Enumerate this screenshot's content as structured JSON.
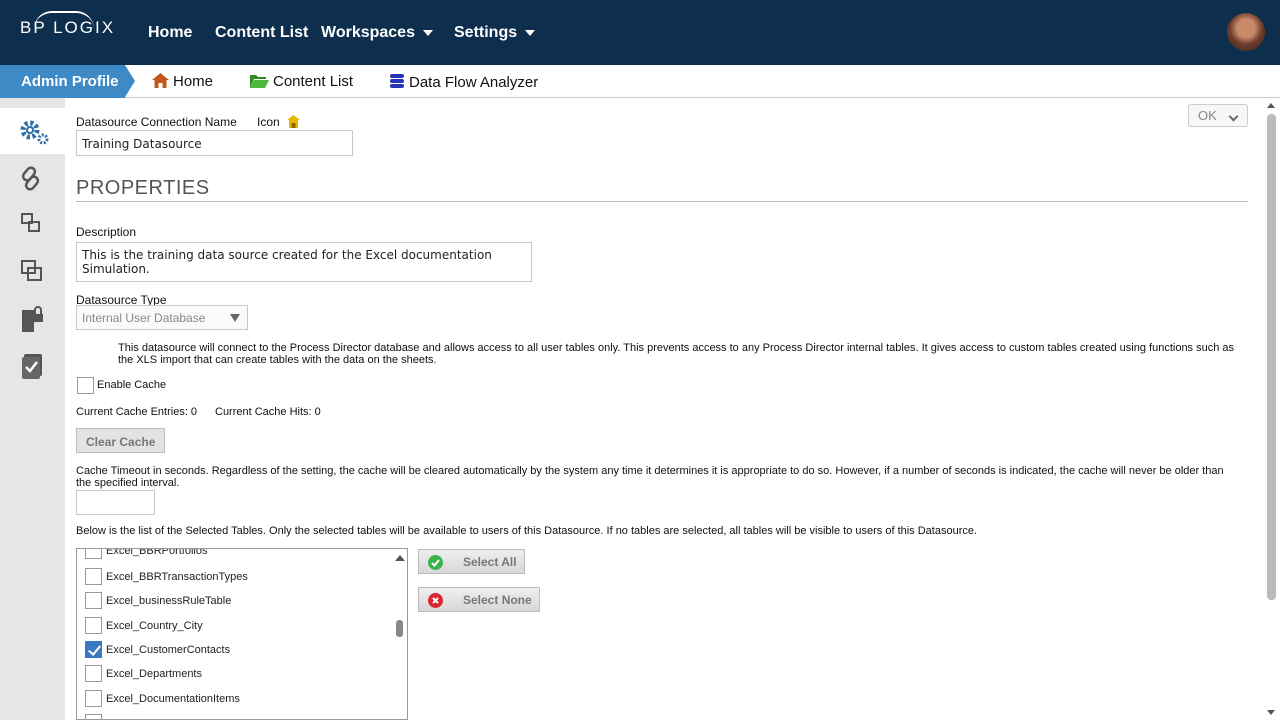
{
  "topnav": {
    "logo": "BP LOGIX",
    "items": [
      {
        "label": "Home"
      },
      {
        "label": "Content List"
      },
      {
        "label": "Workspaces"
      },
      {
        "label": "Settings"
      }
    ],
    "bg_color": "#0d2e4d"
  },
  "breadcrumb": {
    "active": "Admin Profile",
    "items": [
      {
        "label": "Home",
        "icon": "house-icon"
      },
      {
        "label": "Content List",
        "icon": "folder-open-icon"
      },
      {
        "label": "Data Flow Analyzer",
        "icon": "database-icon"
      }
    ],
    "accent_color": "#3e8ac7"
  },
  "sidebar": {
    "icons": [
      "gears-icon",
      "link-icon",
      "relations-icon",
      "copy-icon",
      "lock-document-icon",
      "checklist-icon"
    ]
  },
  "form": {
    "ok_label": "OK",
    "conn_name_label": "Datasource Connection Name",
    "icon_label": "Icon",
    "conn_name_value": "Training Datasource",
    "section_title": "PROPERTIES",
    "description_label": "Description",
    "description_value": "This is the training data source created for the Excel documentation Simulation.",
    "type_label": "Datasource Type",
    "type_value": "Internal User Database",
    "type_help": "This datasource will connect to the Process Director database and allows access to all user tables only. This prevents access to any Process Director internal tables. It gives access to custom tables created using functions such as the XLS import that can create tables with the data on the sheets.",
    "enable_cache_label": "Enable Cache",
    "cache_entries_label": "Current Cache Entries: 0",
    "cache_hits_label": "Current Cache Hits: 0",
    "clear_cache_label": "Clear Cache",
    "timeout_help": "Cache Timeout in seconds. Regardless of the setting, the cache will be cleared automatically by the system any time it determines it is appropriate to do so. However, if a number of seconds is indicated, the cache will never be older than the specified interval.",
    "timeout_value": "",
    "tables_help": "Below is the list of the Selected Tables. Only the selected tables will be available to users of this Datasource. If no tables are selected, all tables will be visible to users of this Datasource.",
    "select_all_label": "Select All",
    "select_none_label": "Select None"
  },
  "tables": [
    {
      "name": "Excel_BBRPortfolios",
      "checked": false
    },
    {
      "name": "Excel_BBRTransactionTypes",
      "checked": false
    },
    {
      "name": "Excel_businessRuleTable",
      "checked": false
    },
    {
      "name": "Excel_Country_City",
      "checked": false
    },
    {
      "name": "Excel_CustomerContacts",
      "checked": true
    },
    {
      "name": "Excel_Departments",
      "checked": false
    },
    {
      "name": "Excel_DocumentationItems",
      "checked": false
    },
    {
      "name": "",
      "checked": false
    }
  ]
}
